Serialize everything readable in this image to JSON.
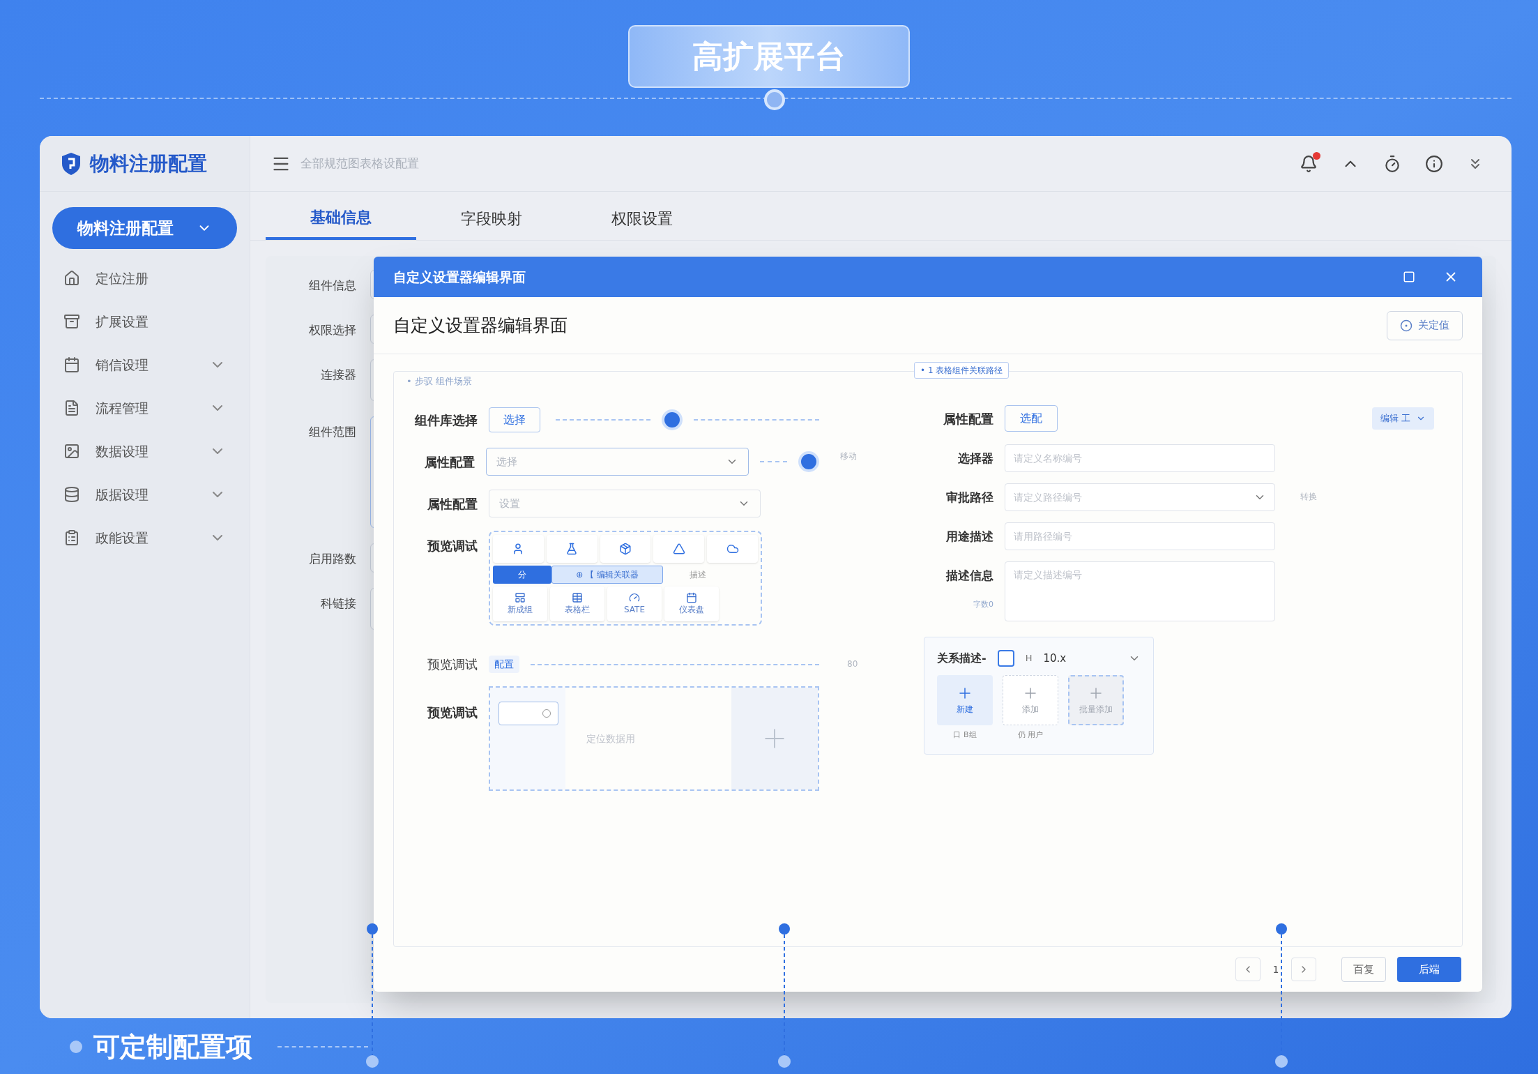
{
  "banner": {
    "title": "高扩展平台"
  },
  "app": {
    "name": "物料注册配置",
    "search": {
      "placeholder": "全部规范图表格设配置"
    },
    "notifications": {
      "unread": true
    }
  },
  "sidebar": {
    "items": [
      {
        "label": "物料注册配置",
        "kind": "group",
        "selected": true
      },
      {
        "label": "定位注册",
        "kind": "link",
        "selected": false
      },
      {
        "label": "扩展设置",
        "kind": "link",
        "selected": false
      },
      {
        "label": "销信设理",
        "kind": "group",
        "selected": false
      },
      {
        "label": "流程管理",
        "kind": "group",
        "selected": false
      },
      {
        "label": "数据设理",
        "kind": "group",
        "selected": false
      },
      {
        "label": "版据设理",
        "kind": "group",
        "selected": false
      },
      {
        "label": "政能设置",
        "kind": "group",
        "selected": false
      }
    ]
  },
  "tabs": [
    {
      "label": "基础信息",
      "selected": true
    },
    {
      "label": "字段映射",
      "selected": false
    },
    {
      "label": "权限设置",
      "selected": false
    }
  ],
  "background_form": [
    {
      "label": "组件信息",
      "kind": "input"
    },
    {
      "label": "权限选择",
      "kind": "input"
    },
    {
      "label": "连接器",
      "kind": "area"
    },
    {
      "label": "组件范围",
      "kind": "tall"
    },
    {
      "label": "启用路数",
      "kind": "input"
    },
    {
      "label": "科链接",
      "kind": "area"
    }
  ],
  "dialog": {
    "title": "自定义设置器编辑界面",
    "heading": "自定义设置器编辑界面",
    "top_button": "关定值",
    "panel_note": "• 步驭  组件场景",
    "path_badge": "• 1 表格组件关联路径",
    "left_rows": [
      {
        "label": "组件库选择",
        "kind": "button",
        "value": "选择"
      },
      {
        "label": "属性配置",
        "kind": "select",
        "placeholder": "选择"
      },
      {
        "label": "属性配置",
        "kind": "select",
        "placeholder": "设置"
      }
    ],
    "grid_label": "预览调试",
    "segments": [
      {
        "label": "分",
        "selected": true,
        "highlighted": false
      },
      {
        "label": "⊕ 【 编辑关联器",
        "selected": false,
        "highlighted": true
      },
      {
        "label": "描述",
        "selected": false,
        "highlighted": false
      }
    ],
    "grid_tiles": [
      "新成组",
      "表格栏",
      "SATE",
      "仪表盘"
    ],
    "config_label": "预览调试",
    "config_tag": "配置",
    "preview_label": "预览调试",
    "preview_hint": "定位数据用",
    "connector_labels": [
      "移动",
      "80"
    ],
    "right_top": {
      "label": "属性配置",
      "button": "选配",
      "dropdown": "编辑  工"
    },
    "right_rows": [
      {
        "label": "选择器",
        "kind": "input",
        "placeholder": "请定义名称编号"
      },
      {
        "label": "审批路径",
        "kind": "select",
        "placeholder": "请定义路径编号"
      },
      {
        "label": "用途描述",
        "kind": "input",
        "placeholder": "请用路径编号"
      },
      {
        "label": "描述信息",
        "kind": "textarea",
        "placeholder": "请定义描述编号",
        "note": "字数0"
      }
    ],
    "right_connector": "转换",
    "relation": {
      "label": "关系描述-",
      "checked": false,
      "unit": "H",
      "value": "10.x",
      "tiles": [
        {
          "label": "新建",
          "caption": "口 B组",
          "kind": "primary"
        },
        {
          "label": "添加",
          "caption": "仍 用户",
          "kind": "plain"
        },
        {
          "label": "批量添加",
          "kind": "dashed"
        }
      ]
    },
    "pagination": {
      "page": "1"
    },
    "buttons": [
      {
        "label": "百复",
        "kind": "secondary"
      },
      {
        "label": "后端",
        "kind": "primary"
      }
    ]
  },
  "feature": {
    "title": "可定制配置项"
  }
}
